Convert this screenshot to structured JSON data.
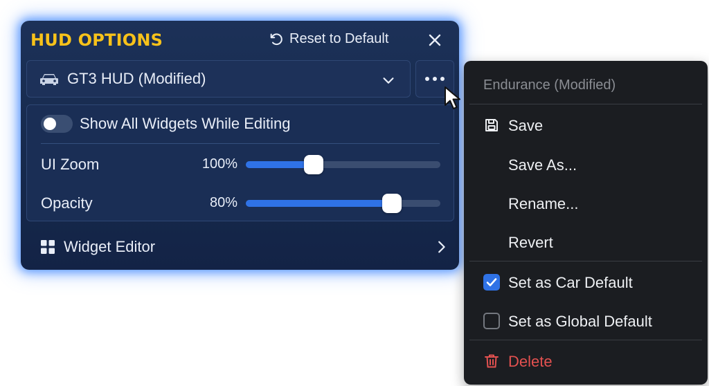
{
  "panel": {
    "title": "HUD OPTIONS",
    "reset_label": "Reset to Default",
    "preset_label": "GT3 HUD (Modified)",
    "toggle_label": "Show All Widgets While Editing",
    "toggle_on": false,
    "sliders": [
      {
        "label": "UI Zoom",
        "value_text": "100%",
        "level": 0.35
      },
      {
        "label": "Opacity",
        "value_text": "80%",
        "level": 0.75
      }
    ],
    "widget_editor_label": "Widget Editor"
  },
  "menu": {
    "header": "Endurance (Modified)",
    "items": [
      {
        "label": "Save",
        "icon": "floppy-disk-icon"
      },
      {
        "label": "Save As..."
      },
      {
        "label": "Rename..."
      },
      {
        "label": "Revert"
      }
    ],
    "checkboxes": [
      {
        "label": "Set as Car Default",
        "checked": true
      },
      {
        "label": "Set as Global Default",
        "checked": false
      }
    ],
    "delete_label": "Delete"
  },
  "colors": {
    "title_accent": "#f7c21a",
    "slider_fill": "#2f72e6",
    "danger": "#e35150",
    "checkbox_checked": "#2f72e6"
  }
}
